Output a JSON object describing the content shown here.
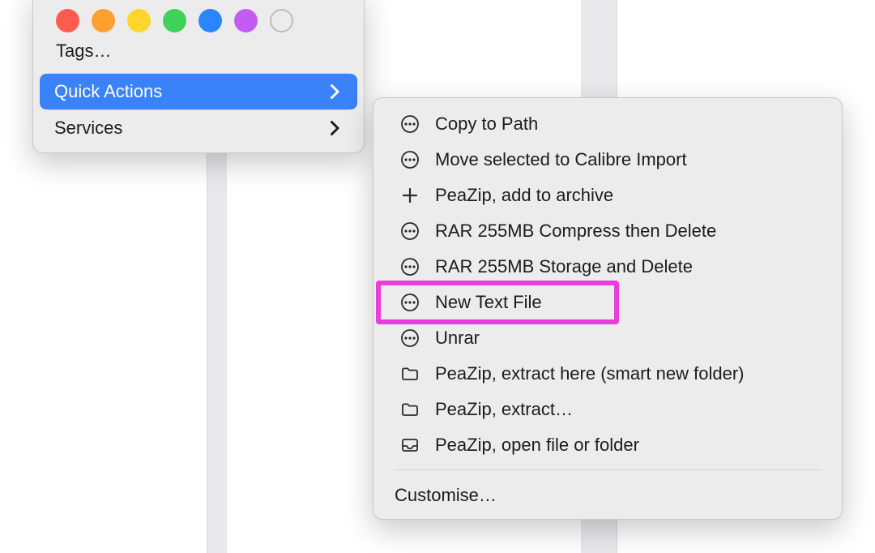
{
  "colors": {
    "selection": "#3a82f7",
    "highlight_border": "#e83ddb",
    "menu_bg": "#ececec"
  },
  "tags": {
    "label": "Tags…",
    "dots": [
      {
        "name": "red",
        "color": "#ff5c50"
      },
      {
        "name": "orange",
        "color": "#ff9f2d"
      },
      {
        "name": "yellow",
        "color": "#ffd52e"
      },
      {
        "name": "green",
        "color": "#3fd158"
      },
      {
        "name": "blue",
        "color": "#2a86ff"
      },
      {
        "name": "purple",
        "color": "#c35cf2"
      },
      {
        "name": "none",
        "color": null
      }
    ]
  },
  "primary_menu": {
    "quick_actions": "Quick Actions",
    "services": "Services"
  },
  "submenu": {
    "items": [
      {
        "icon": "ellipsis",
        "label": "Copy to Path"
      },
      {
        "icon": "ellipsis",
        "label": "Move selected to Calibre Import"
      },
      {
        "icon": "plus",
        "label": "PeaZip, add to archive"
      },
      {
        "icon": "ellipsis",
        "label": "RAR 255MB Compress then Delete"
      },
      {
        "icon": "ellipsis",
        "label": "RAR 255MB Storage and Delete"
      },
      {
        "icon": "ellipsis",
        "label": "New Text File"
      },
      {
        "icon": "ellipsis",
        "label": "Unrar"
      },
      {
        "icon": "folder",
        "label": "PeaZip, extract here (smart new folder)"
      },
      {
        "icon": "folder",
        "label": "PeaZip, extract…"
      },
      {
        "icon": "tray",
        "label": "PeaZip, open file or folder"
      }
    ],
    "customise": "Customise…",
    "highlighted_index": 5
  }
}
